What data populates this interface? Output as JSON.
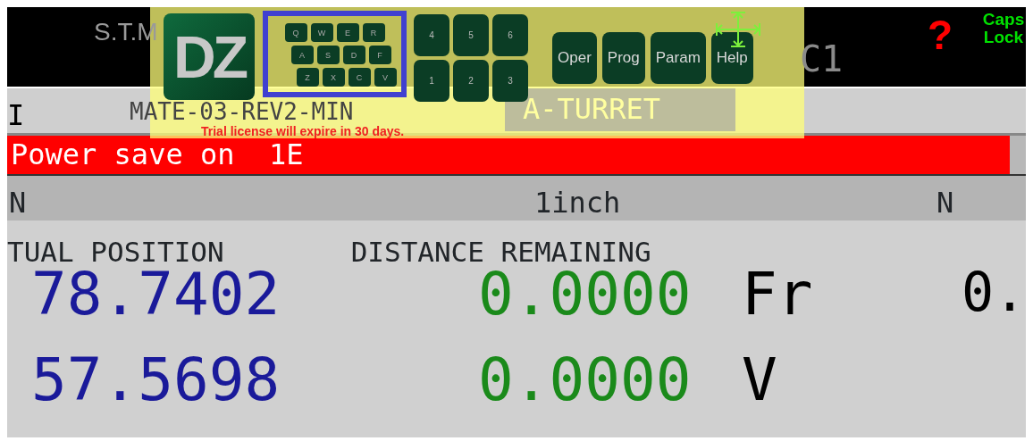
{
  "header": {
    "title_fragment": "S.T.M",
    "tool_code": "C1",
    "help_glyph": "?",
    "caps_lock": "Caps Lock"
  },
  "program_row": {
    "left_fragment": "I",
    "program_name": "MATE-03-REV2-MIN",
    "turret": "A-TURRET"
  },
  "status_bar": {
    "message": "Power save on  1E"
  },
  "units_row": {
    "left_fragment": "N",
    "unit": "1inch",
    "right_fragment": "N"
  },
  "position": {
    "labels": [
      "TUAL POSITION",
      "DISTANCE REMAINING"
    ],
    "rows": [
      {
        "actual": "78.7402",
        "remaining": "0.0000",
        "label": "Fr",
        "value": "0."
      },
      {
        "actual": "57.5698",
        "remaining": "0.0000",
        "label": "V",
        "value": ""
      }
    ]
  },
  "overlay": {
    "logo": "DZ",
    "keyboard_rows": [
      [
        "Q",
        "W",
        "E",
        "R"
      ],
      [
        "A",
        "S",
        "D",
        "F"
      ],
      [
        "Z",
        "X",
        "C",
        "V"
      ]
    ],
    "numpad_rows": [
      [
        "4",
        "5",
        "6"
      ],
      [
        "1",
        "2",
        "3"
      ]
    ],
    "nav_buttons": [
      "Oper",
      "Prog",
      "Param",
      "Help"
    ],
    "notice": "Trial license will expire in 30 days."
  }
}
